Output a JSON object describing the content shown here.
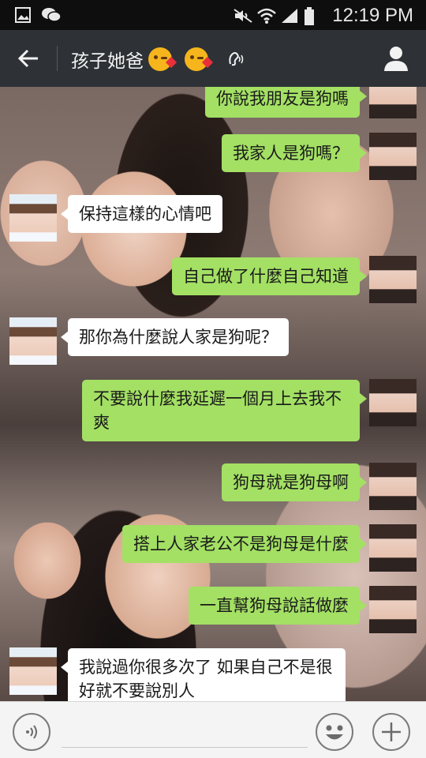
{
  "status_bar": {
    "time": "12:19 PM",
    "left_icons": [
      "gallery-icon",
      "wechat-icon"
    ],
    "right_icons": [
      "mute-icon",
      "wifi-icon",
      "signal-icon",
      "battery-icon"
    ]
  },
  "header": {
    "title": "孩子她爸",
    "title_emojis": [
      "kissing-heart-emoji",
      "kissing-heart-emoji"
    ],
    "earpiece_icon": "earpiece-icon",
    "back_icon": "back-arrow-icon",
    "profile_icon": "person-icon"
  },
  "messages": [
    {
      "sender": "self",
      "text": "你說我朋友是狗嗎"
    },
    {
      "sender": "self",
      "text": "我家人是狗嗎？"
    },
    {
      "sender": "other",
      "text": "保持這樣的心情吧"
    },
    {
      "sender": "self",
      "text": "自己做了什麼自己知道"
    },
    {
      "sender": "other",
      "text": "那你為什麼說人家是狗呢？"
    },
    {
      "sender": "self",
      "text": "不要說什麼我延遲一個月上去我不爽"
    },
    {
      "sender": "self",
      "text": "狗母就是狗母啊"
    },
    {
      "sender": "self",
      "text": "搭上人家老公不是狗母是什麼"
    },
    {
      "sender": "self",
      "text": "一直幫狗母說話做麼"
    },
    {
      "sender": "other",
      "text": "我說過你很多次了 如果自己不是很好就不要說別人"
    }
  ],
  "input_bar": {
    "placeholder": "",
    "voice_icon": "voice-icon",
    "emoji_icon": "smiley-icon",
    "plus_icon": "plus-icon"
  },
  "colors": {
    "status_bar_bg": "#0e0e0e",
    "header_bg": "#2e3236",
    "self_bubble": "#a3e064",
    "other_bubble": "#ffffff",
    "input_bar_bg": "#f4f4f4"
  }
}
